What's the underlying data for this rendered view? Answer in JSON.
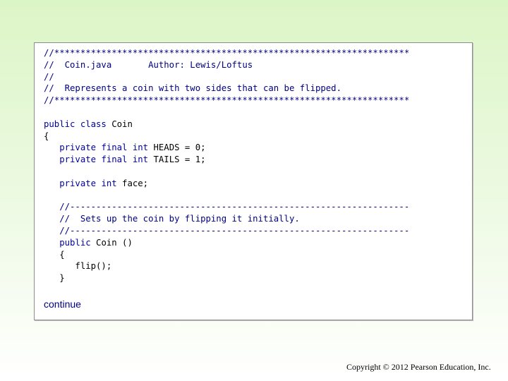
{
  "code": {
    "lines": [
      [
        {
          "t": "//********************************************************************",
          "c": "cm"
        }
      ],
      [
        {
          "t": "//  Coin.java       Author: Lewis/Loftus",
          "c": "cm"
        }
      ],
      [
        {
          "t": "//",
          "c": "cm"
        }
      ],
      [
        {
          "t": "//  Represents a coin with two sides that can be flipped.",
          "c": "cm"
        }
      ],
      [
        {
          "t": "//********************************************************************",
          "c": "cm"
        }
      ],
      [],
      [
        {
          "t": "public class",
          "c": "kw"
        },
        {
          "t": " Coin",
          "c": ""
        }
      ],
      [
        {
          "t": "{",
          "c": ""
        }
      ],
      [
        {
          "t": "   ",
          "c": ""
        },
        {
          "t": "private final int",
          "c": "kw"
        },
        {
          "t": " HEADS = 0;",
          "c": ""
        }
      ],
      [
        {
          "t": "   ",
          "c": ""
        },
        {
          "t": "private final int",
          "c": "kw"
        },
        {
          "t": " TAILS = 1;",
          "c": ""
        }
      ],
      [],
      [
        {
          "t": "   ",
          "c": ""
        },
        {
          "t": "private int",
          "c": "kw"
        },
        {
          "t": " face;",
          "c": ""
        }
      ],
      [],
      [
        {
          "t": "   //-----------------------------------------------------------------",
          "c": "cm"
        }
      ],
      [
        {
          "t": "   //  Sets up the coin by flipping it initially.",
          "c": "cm"
        }
      ],
      [
        {
          "t": "   //-----------------------------------------------------------------",
          "c": "cm"
        }
      ],
      [
        {
          "t": "   ",
          "c": ""
        },
        {
          "t": "public",
          "c": "kw"
        },
        {
          "t": " Coin ()",
          "c": ""
        }
      ],
      [
        {
          "t": "   {",
          "c": ""
        }
      ],
      [
        {
          "t": "      flip();",
          "c": ""
        }
      ],
      [
        {
          "t": "   }",
          "c": ""
        }
      ]
    ]
  },
  "continue_label": "continue",
  "copyright": "Copyright © 2012 Pearson Education, Inc."
}
